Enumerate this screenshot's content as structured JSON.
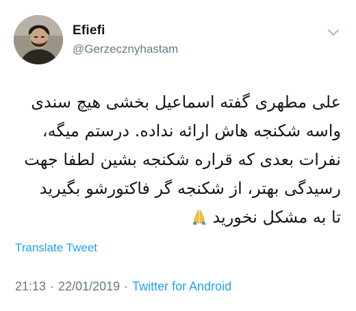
{
  "user": {
    "display_name": "Efiefi",
    "handle": "@Gerzecznyhastam"
  },
  "tweet": {
    "lines": [
      "علی مطهری گفته اسماعیل بخشی هیچ سندی",
      "واسه شکنجه هاش ارائه نداده. درستم میگه،",
      "نفرات بعدی که قراره شکنجه بشین لطفا جهت",
      "رسیدگی بهتر، از شکنجه گر فاکتورشو بگیرید",
      "تا به مشکل نخورید"
    ],
    "emoji_icon": "folded-hands-icon"
  },
  "translate_label": "Translate Tweet",
  "meta": {
    "time": "21:13",
    "date": "22/01/2019",
    "separator": "·",
    "source": "Twitter for Android"
  },
  "colors": {
    "link": "#1da1f2",
    "secondary_text": "#657786",
    "primary_text": "#14171a"
  }
}
